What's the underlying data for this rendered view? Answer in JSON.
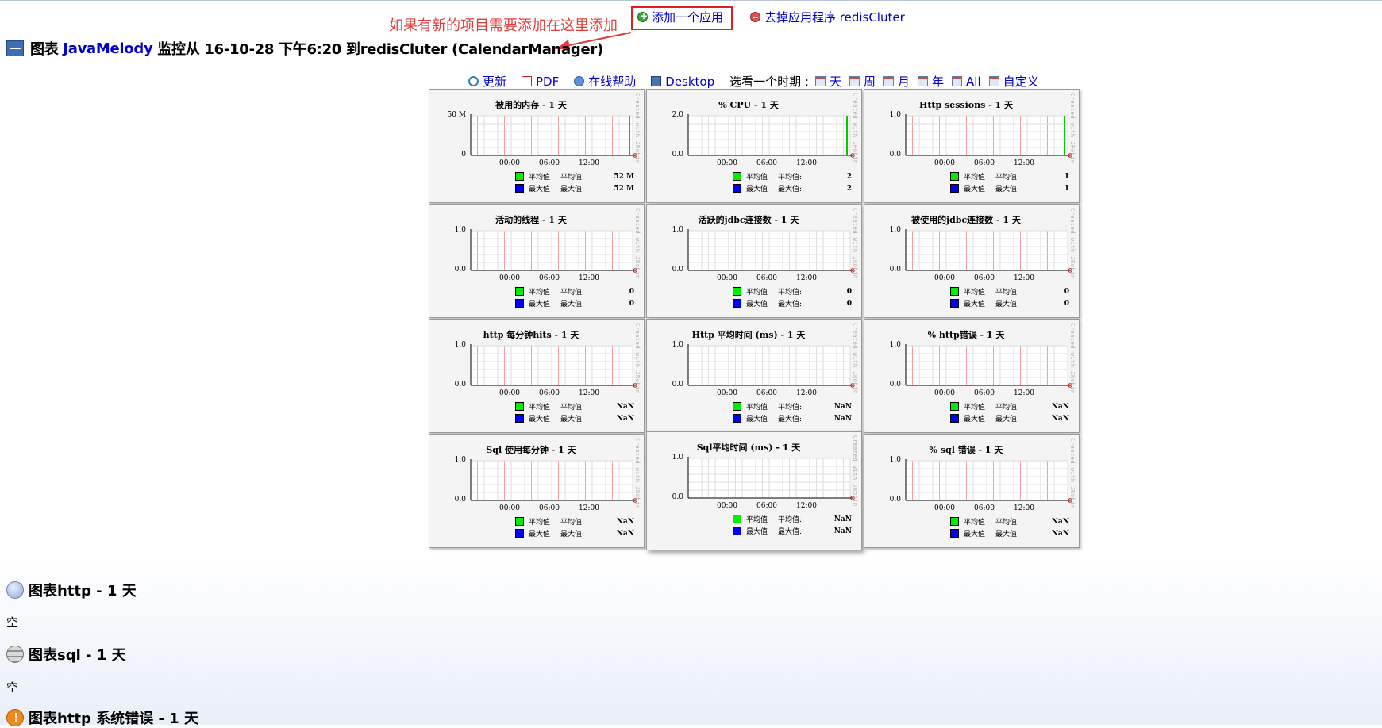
{
  "annotation": {
    "note": "如果有新的项目需要添加在这里添加",
    "color": "#e43c3c"
  },
  "top_actions": {
    "add_label": "添加一个应用",
    "remove_label": "去掉应用程序 redisCluter"
  },
  "header": {
    "prefix": "图表 ",
    "brand": "JavaMelody",
    "suffix": " 监控从 16-10-28 下午6:20 到redisCluter (CalendarManager)"
  },
  "toolbar": {
    "refresh": "更新",
    "pdf": "PDF",
    "help": "在线帮助",
    "desktop": "Desktop",
    "choose_period": "选看一个时期 :",
    "periods": [
      "天",
      "周",
      "月",
      "年",
      "All",
      "自定义"
    ]
  },
  "chart_common": {
    "x_ticks": [
      "00:00",
      "06:00",
      "12:00"
    ],
    "legend_avg": "平均值",
    "legend_avg_label": "平均值:",
    "legend_max": "最大值",
    "legend_max_label": "最大值:",
    "watermark": "Created with JRobin",
    "avg_color": "#00ee00",
    "max_color": "#0000ee"
  },
  "chart_data": [
    {
      "type": "area",
      "title": "被用的内存 - 1 天",
      "y_ticks": [
        "50 M",
        "0"
      ],
      "ylim": [
        0,
        50
      ],
      "x": [
        "00:00",
        "06:00",
        "12:00"
      ],
      "series": [
        {
          "name": "平均值",
          "last_value": 52
        },
        {
          "name": "最大值",
          "last_value": 52
        }
      ],
      "avg_value": "52 M",
      "max_value": "52 M",
      "spike": true
    },
    {
      "type": "area",
      "title": "% CPU - 1 天",
      "y_ticks": [
        "2.0",
        "0.0"
      ],
      "ylim": [
        0,
        2
      ],
      "x": [
        "00:00",
        "06:00",
        "12:00"
      ],
      "series": [
        {
          "name": "平均值",
          "last_value": 2
        },
        {
          "name": "最大值",
          "last_value": 2
        }
      ],
      "avg_value": "2",
      "max_value": "2",
      "spike": true
    },
    {
      "type": "area",
      "title": "Http sessions - 1 天",
      "y_ticks": [
        "1.0",
        "0.0"
      ],
      "ylim": [
        0,
        1
      ],
      "x": [
        "00:00",
        "06:00",
        "12:00"
      ],
      "series": [
        {
          "name": "平均值",
          "last_value": 1
        },
        {
          "name": "最大值",
          "last_value": 1
        }
      ],
      "avg_value": "1",
      "max_value": "1",
      "spike": true
    },
    {
      "type": "area",
      "title": "活动的线程 - 1 天",
      "y_ticks": [
        "1.0",
        "0.0"
      ],
      "ylim": [
        0,
        1
      ],
      "x": [
        "00:00",
        "06:00",
        "12:00"
      ],
      "series": [
        {
          "name": "平均值",
          "last_value": 0
        },
        {
          "name": "最大值",
          "last_value": 0
        }
      ],
      "avg_value": "0",
      "max_value": "0",
      "spike": false
    },
    {
      "type": "area",
      "title": "活跃的jdbc连接数 - 1 天",
      "y_ticks": [
        "1.0",
        "0.0"
      ],
      "ylim": [
        0,
        1
      ],
      "x": [
        "00:00",
        "06:00",
        "12:00"
      ],
      "series": [
        {
          "name": "平均值",
          "last_value": 0
        },
        {
          "name": "最大值",
          "last_value": 0
        }
      ],
      "avg_value": "0",
      "max_value": "0",
      "spike": false
    },
    {
      "type": "area",
      "title": "被使用的jdbc连接数 - 1 天",
      "y_ticks": [
        "1.0",
        "0.0"
      ],
      "ylim": [
        0,
        1
      ],
      "x": [
        "00:00",
        "06:00",
        "12:00"
      ],
      "series": [
        {
          "name": "平均值",
          "last_value": 0
        },
        {
          "name": "最大值",
          "last_value": 0
        }
      ],
      "avg_value": "0",
      "max_value": "0",
      "spike": false
    },
    {
      "type": "area",
      "title": "http 每分钟hits - 1 天",
      "y_ticks": [
        "1.0",
        "0.0"
      ],
      "ylim": [
        0,
        1
      ],
      "x": [
        "00:00",
        "06:00",
        "12:00"
      ],
      "series": [
        {
          "name": "平均值",
          "last_value": null
        },
        {
          "name": "最大值",
          "last_value": null
        }
      ],
      "avg_value": "NaN",
      "max_value": "NaN",
      "spike": false
    },
    {
      "type": "area",
      "title": "Http 平均时间 (ms) - 1 天",
      "y_ticks": [
        "1.0",
        "0.0"
      ],
      "ylim": [
        0,
        1
      ],
      "x": [
        "00:00",
        "06:00",
        "12:00"
      ],
      "series": [
        {
          "name": "平均值",
          "last_value": null
        },
        {
          "name": "最大值",
          "last_value": null
        }
      ],
      "avg_value": "NaN",
      "max_value": "NaN",
      "spike": false
    },
    {
      "type": "area",
      "title": "% http错误 - 1 天",
      "y_ticks": [
        "1.0",
        "0.0"
      ],
      "ylim": [
        0,
        1
      ],
      "x": [
        "00:00",
        "06:00",
        "12:00"
      ],
      "series": [
        {
          "name": "平均值",
          "last_value": null
        },
        {
          "name": "最大值",
          "last_value": null
        }
      ],
      "avg_value": "NaN",
      "max_value": "NaN",
      "spike": false
    },
    {
      "type": "area",
      "title": "Sql 使用每分钟 - 1 天",
      "y_ticks": [
        "1.0",
        "0.0"
      ],
      "ylim": [
        0,
        1
      ],
      "x": [
        "00:00",
        "06:00",
        "12:00"
      ],
      "series": [
        {
          "name": "平均值",
          "last_value": null
        },
        {
          "name": "最大值",
          "last_value": null
        }
      ],
      "avg_value": "NaN",
      "max_value": "NaN",
      "spike": false
    },
    {
      "type": "area",
      "title": "Sql平均时间 (ms) - 1 天",
      "y_ticks": [
        "1.0",
        "0.0"
      ],
      "ylim": [
        0,
        1
      ],
      "x": [
        "00:00",
        "06:00",
        "12:00"
      ],
      "series": [
        {
          "name": "平均值",
          "last_value": null
        },
        {
          "name": "最大值",
          "last_value": null
        }
      ],
      "avg_value": "NaN",
      "max_value": "NaN",
      "spike": false
    },
    {
      "type": "area",
      "title": "% sql 错误 - 1 天",
      "y_ticks": [
        "1.0",
        "0.0"
      ],
      "ylim": [
        0,
        1
      ],
      "x": [
        "00:00",
        "06:00",
        "12:00"
      ],
      "series": [
        {
          "name": "平均值",
          "last_value": null
        },
        {
          "name": "最大值",
          "last_value": null
        }
      ],
      "avg_value": "NaN",
      "max_value": "NaN",
      "spike": false
    }
  ],
  "sections": [
    {
      "title": "图表http - 1 天",
      "icon": "globe-icon",
      "empty": "空"
    },
    {
      "title": "图表sql - 1 天",
      "icon": "database-icon",
      "empty": "空"
    },
    {
      "title": "图表http 系统错误 - 1 天",
      "icon": "warning-icon"
    }
  ]
}
